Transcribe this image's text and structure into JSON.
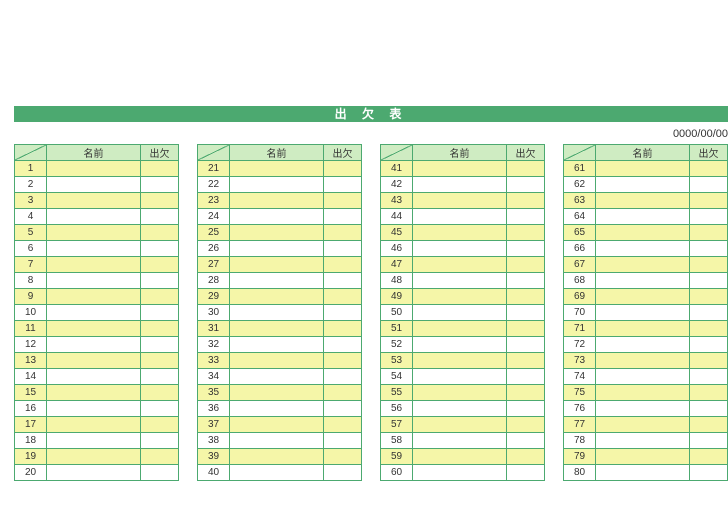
{
  "title": "出 欠 表",
  "date": "0000/00/00",
  "headers": {
    "name": "名前",
    "attendance": "出欠"
  },
  "columns": [
    {
      "start": 1,
      "end": 20
    },
    {
      "start": 21,
      "end": 40
    },
    {
      "start": 41,
      "end": 60
    },
    {
      "start": 61,
      "end": 80
    }
  ]
}
